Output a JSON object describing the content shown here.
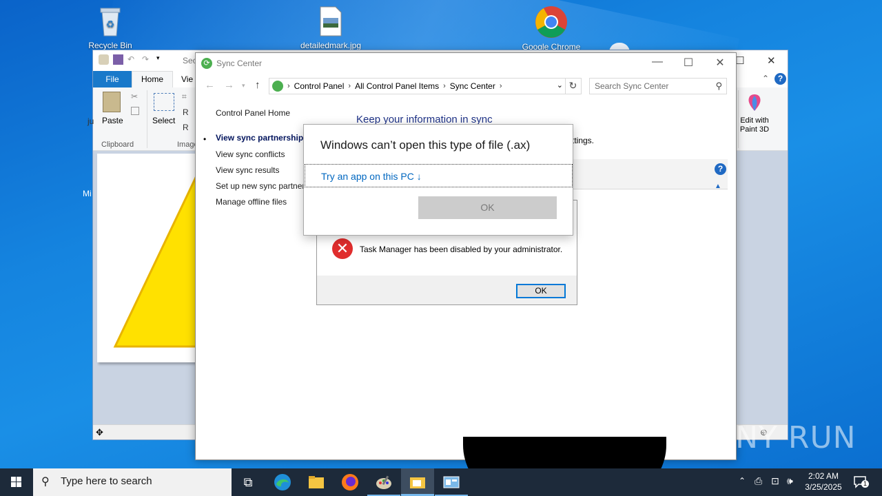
{
  "desktop": {
    "icons": [
      {
        "label": "Recycle Bin",
        "icon": "recycle-bin-icon"
      },
      {
        "label": "detailedmark.jpg",
        "icon": "image-file-icon"
      },
      {
        "label": "Google Chrome",
        "icon": "chrome-icon"
      }
    ],
    "side_labels": {
      "ju": "ju",
      "mi": "Mi"
    }
  },
  "paint": {
    "title_fragment": "Sec",
    "tabs": {
      "file": "File",
      "home": "Home",
      "view": "Vie"
    },
    "ribbon": {
      "paste": "Paste",
      "select": "Select",
      "clipboard_group": "Clipboard",
      "image_group": "Image",
      "edit_paint3d": "Edit with\nPaint 3D",
      "r1": "R",
      "r2": "R"
    }
  },
  "sync_center": {
    "title": "Sync Center",
    "breadcrumb": [
      "Control Panel",
      "All Control Panel Items",
      "Sync Center"
    ],
    "search_placeholder": "Search Sync Center",
    "left_links": {
      "home": "Control Panel Home",
      "partnerships": "View sync partnerships",
      "conflicts": "View sync conflicts",
      "results": "View sync results",
      "setup": "Set up new sync partner",
      "offline": "Manage offline files"
    },
    "heading": "Keep your information in sync",
    "settings_fragment": "ttings."
  },
  "taskmgr_dialog": {
    "message": "Task Manager has been disabled by your administrator.",
    "ok": "OK"
  },
  "open_with_dialog": {
    "title": "Windows can’t open this type of file (.ax)",
    "try_app": "Try an app on this PC",
    "ok": "OK"
  },
  "taskbar": {
    "search_placeholder": "Type here to search",
    "time": "2:02 AM",
    "date": "3/25/2025",
    "notification_count": "1"
  },
  "watermark": "ANY RUN",
  "colors": {
    "desktop_blue": "#1584df",
    "link_blue": "#0067c0",
    "heading_blue": "#1e3287",
    "taskbar": "#1d2a3a",
    "error_red": "#e02d2d"
  }
}
